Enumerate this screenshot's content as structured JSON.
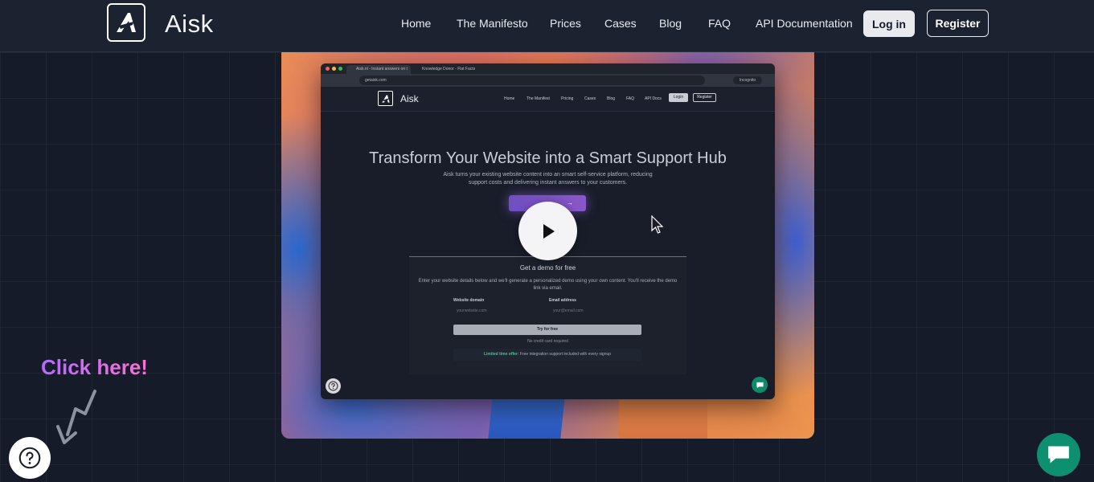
{
  "header": {
    "logo_text": "Aisk",
    "nav": [
      "Home",
      "The Manifesto",
      "Prices",
      "Cases",
      "Blog",
      "FAQ",
      "API Documentation"
    ],
    "login_label": "Log in",
    "register_label": "Register"
  },
  "video": {
    "browser": {
      "tabs": [
        "Aisk.nl - Instant answers on t",
        "Knowledge Donor - Flat Facts"
      ],
      "url": "getaisk.com",
      "incognito_label": "Incognito"
    },
    "inner_header": {
      "logo_text": "Aisk",
      "nav": [
        "Home",
        "The Manifest",
        "Pricing",
        "Cases",
        "Blog",
        "FAQ",
        "API Docs"
      ],
      "login_label": "Login",
      "register_label": "Register"
    },
    "hero": {
      "title": "Transform Your Website into a Smart Support Hub",
      "subtitle": "Aisk turns your existing website content into an smart self-service platform, reducing support costs and delivering instant answers to your customers."
    },
    "demo": {
      "title": "Get a demo for free",
      "description": "Enter your website details below and we'll generate a personalized demo using your own content. You'll receive the demo link via email.",
      "domain_label": "Website domain",
      "domain_placeholder": "yourwebsite.com",
      "email_label": "Email address",
      "email_placeholder": "your@email.com",
      "try_label": "Try for free",
      "no_card": "No credit card required",
      "offer_strong": "Limited time offer:",
      "offer_text": " Free integration support included with every signup"
    }
  },
  "overlay": {
    "click_here": "Click here!"
  },
  "icons": {
    "logo": "aisk-logo-icon",
    "play": "play-icon",
    "help": "question-icon",
    "chat": "chat-bubble-icon",
    "arrow": "zigzag-arrow-icon",
    "cursor": "mouse-cursor-icon"
  },
  "colors": {
    "background": "#151b28",
    "header": "#1b2230",
    "chat_button": "#0e8f70",
    "click_here_start": "#b36bff",
    "click_here_end": "#ff6fd2"
  }
}
